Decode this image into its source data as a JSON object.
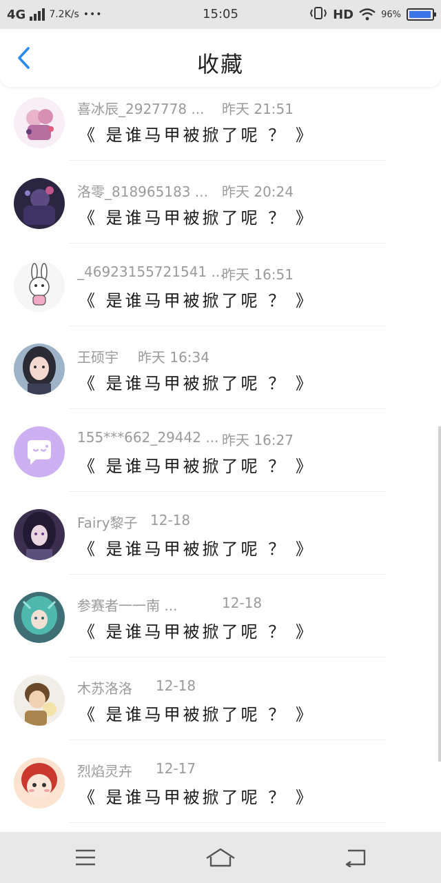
{
  "status_bar": {
    "network": "4G",
    "speed": "7.2K/s",
    "more": "•••",
    "time": "15:05",
    "hd": "HD",
    "battery_text": "96%",
    "battery_level": 0.96,
    "icons": [
      "signal-icon",
      "vibrate-icon",
      "wifi-icon",
      "battery-icon"
    ],
    "accent": "#3b74e8"
  },
  "header": {
    "title": "收藏",
    "back_icon": "back-chevron-icon",
    "back_color": "#2a8cf0"
  },
  "items": [
    {
      "name": "喜冰辰_2927778 ...",
      "time": "昨天 21:51",
      "content": "《 是谁马甲被掀了呢 ？ 》"
    },
    {
      "name": "洛零_818965183 ...",
      "time": "昨天 20:24",
      "content": "《 是谁马甲被掀了呢 ？ 》"
    },
    {
      "name": "_46923155721541 ...",
      "time": "昨天 16:51",
      "content": "《 是谁马甲被掀了呢 ？ 》"
    },
    {
      "name": "王硕宇",
      "time": "昨天 16:34",
      "content": "《 是谁马甲被掀了呢 ？ 》"
    },
    {
      "name": "155***662_29442 ...",
      "time": "昨天 16:27",
      "content": "《 是谁马甲被掀了呢 ？ 》"
    },
    {
      "name": "Fairy黎子",
      "time": "12-18",
      "content": "《 是谁马甲被掀了呢 ？ 》"
    },
    {
      "name": "参赛者一一南 ...",
      "time": "12-18",
      "content": "《 是谁马甲被掀了呢 ？ 》"
    },
    {
      "name": "木苏洛洛",
      "time": "12-18",
      "content": "《 是谁马甲被掀了呢 ？ 》"
    },
    {
      "name": "烈焰灵卉",
      "time": "12-17",
      "content": "《 是谁马甲被掀了呢 ？ 》"
    }
  ],
  "nav_bar": {
    "icons": [
      "menu-icon",
      "home-icon",
      "back-icon"
    ]
  }
}
